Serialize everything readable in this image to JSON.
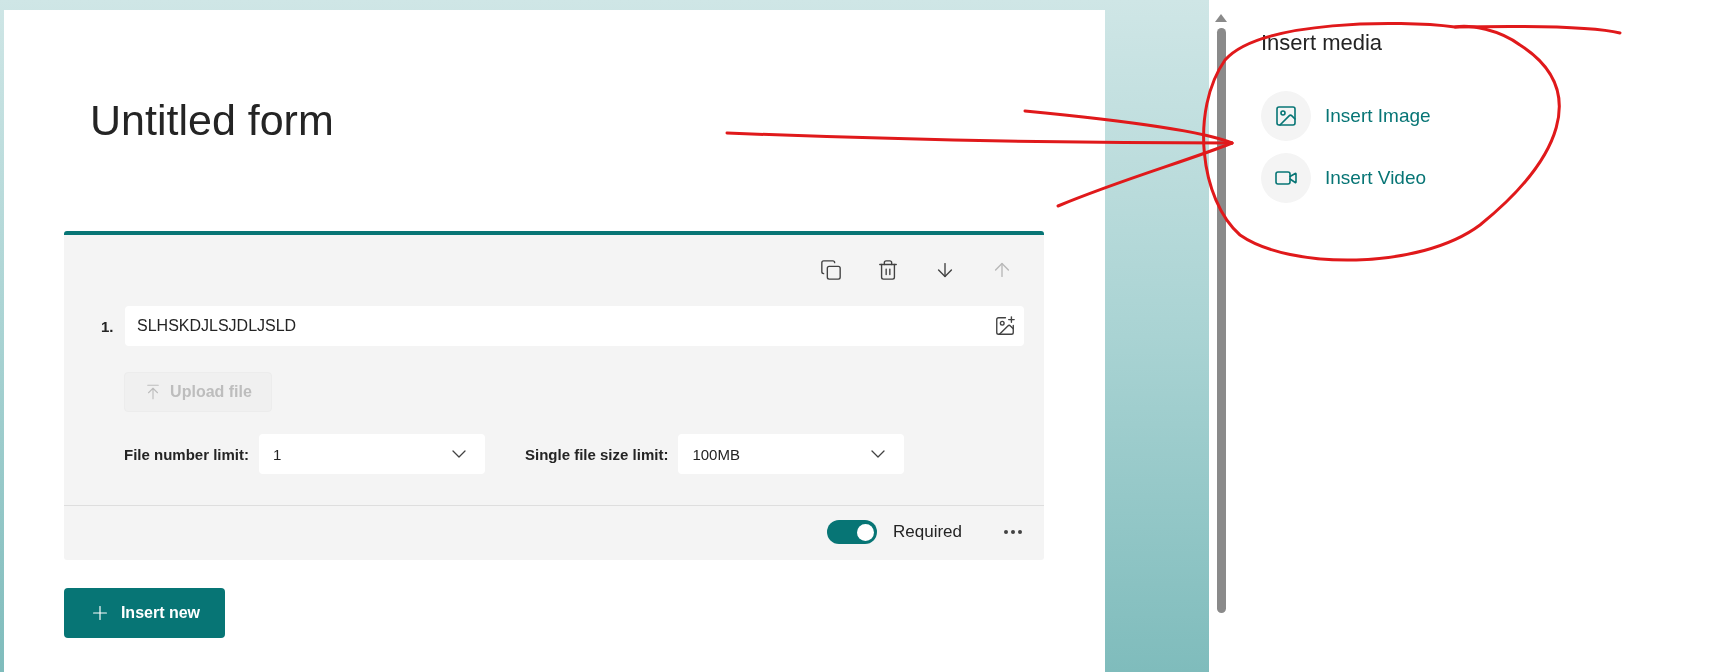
{
  "form": {
    "title": "Untitled form"
  },
  "question": {
    "number": "1.",
    "text": "SLHSKDJLSJDLJSLD",
    "toolbar": [
      {
        "kind": "copy",
        "disabled": false
      },
      {
        "kind": "delete",
        "disabled": false
      },
      {
        "kind": "move_down",
        "disabled": false
      },
      {
        "kind": "move_up",
        "disabled": true
      }
    ],
    "upload_button": {
      "label": "Upload file",
      "disabled": true
    },
    "limits": [
      {
        "label": "File number limit:",
        "value": "1"
      },
      {
        "label": "Single file size limit:",
        "value": "100MB"
      }
    ],
    "required": {
      "label": "Required",
      "on": true
    }
  },
  "insert_new": {
    "label": "Insert new"
  },
  "insert_media": {
    "title": "Insert media",
    "items": [
      {
        "kind": "image",
        "label": "Insert Image"
      },
      {
        "kind": "video",
        "label": "Insert Video"
      }
    ]
  }
}
